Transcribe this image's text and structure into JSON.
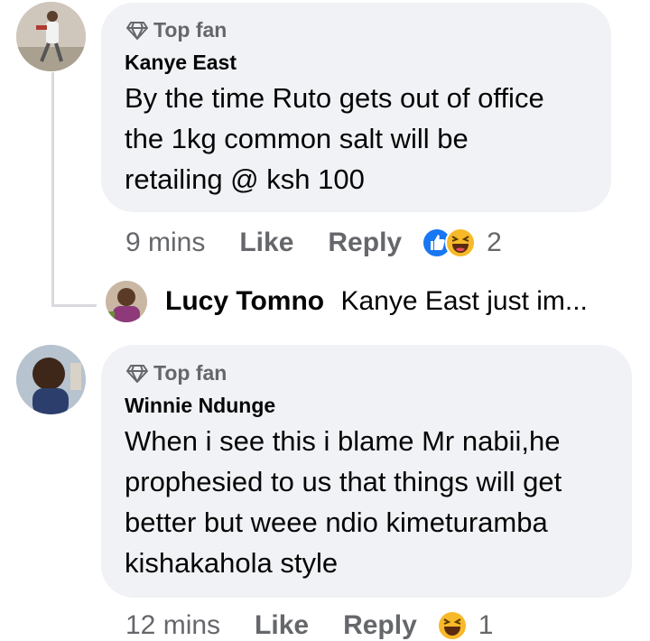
{
  "comments": [
    {
      "badge": "Top fan",
      "author": "Kanye East",
      "lines": [
        "By the time Ruto gets out of office",
        "the 1kg common salt will be",
        "retailing @ ksh 100"
      ],
      "time": "9 mins",
      "like": "Like",
      "reply": "Reply",
      "reaction_count": "2",
      "reactions": [
        "like-icon",
        "haha-icon"
      ]
    },
    {
      "badge": "Top fan",
      "author": "Winnie Ndunge",
      "lines": [
        "When i see this i blame Mr nabii,he",
        "prophesied to us that things will get",
        "better but weee ndio kimeturamba",
        "kishakahola style"
      ],
      "time": "12 mins",
      "like": "Like",
      "reply": "Reply",
      "reaction_count": "1",
      "reactions": [
        "haha-icon"
      ]
    }
  ],
  "reply_preview": {
    "author": "Lucy Tomno",
    "text": "Kanye East just im..."
  },
  "colors": {
    "bubble": "#f0f2f5",
    "secondary_text": "#65676b",
    "like_blue": "#1877f2",
    "haha_yellow": "#f7b928"
  }
}
